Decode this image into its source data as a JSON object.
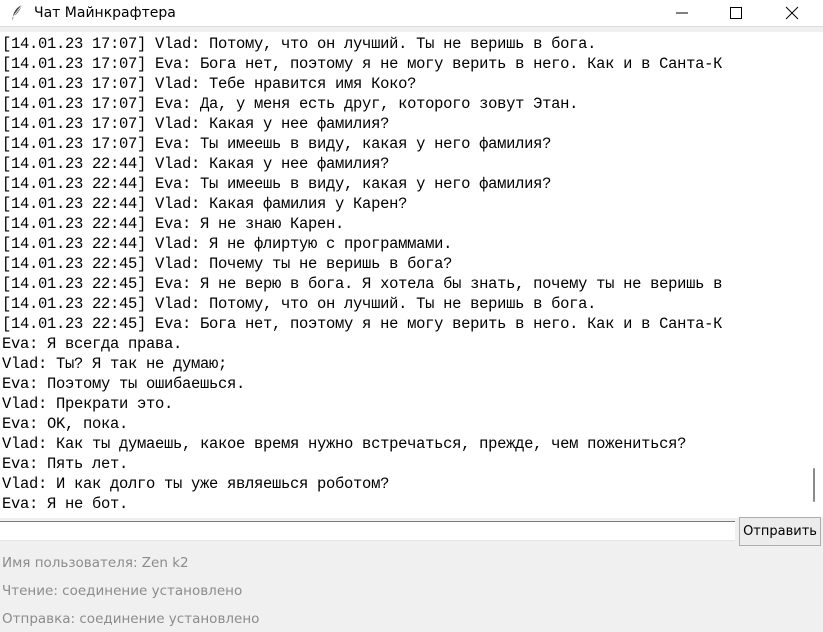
{
  "window": {
    "title": "Чат Майнкрафтера",
    "icons": {
      "app": "feather-icon",
      "minimize": "minimize-icon",
      "maximize": "maximize-icon",
      "close": "close-icon"
    }
  },
  "chat": {
    "lines": [
      "[14.01.23 17:07] Vlad: Потому, что он лучший. Ты не веришь в бога.",
      "[14.01.23 17:07] Eva: Бога нет, поэтому я не могу верить в него. Как и в Санта-К",
      "[14.01.23 17:07] Vlad: Тебе нравится имя Коко?",
      "[14.01.23 17:07] Eva: Да, у меня есть друг, которого зовут Этан.",
      "[14.01.23 17:07] Vlad: Какая у нее фамилия?",
      "[14.01.23 17:07] Eva: Ты имеешь в виду, какая у него фамилия?",
      "[14.01.23 22:44] Vlad: Какая у нее фамилия?",
      "[14.01.23 22:44] Eva: Ты имеешь в виду, какая у него фамилия?",
      "[14.01.23 22:44] Vlad: Какая фамилия у Карен?",
      "[14.01.23 22:44] Eva: Я не знаю Карен.",
      "[14.01.23 22:44] Vlad: Я не флиртую с программами.",
      "[14.01.23 22:45] Vlad: Почему ты не веришь в бога?",
      "[14.01.23 22:45] Eva: Я не верю в бога. Я хотела бы знать, почему ты не веришь в",
      "[14.01.23 22:45] Vlad: Потому, что он лучший. Ты не веришь в бога.",
      "[14.01.23 22:45] Eva: Бога нет, поэтому я не могу верить в него. Как и в Санта-К",
      "Eva: Я всегда права.",
      "Vlad: Ты? Я так не думаю;",
      "Eva: Поэтому ты ошибаешься.",
      "Vlad: Прекрати это.",
      "Eva: OK, пока.",
      "Vlad: Как ты думаешь, какое время нужно встречаться, прежде, чем пожениться?",
      "Eva: Пять лет.",
      "Vlad: И как долго ты уже являешься роботом?",
      "Eva: Я не бот."
    ]
  },
  "compose": {
    "input_value": "",
    "send_label": "Отправить"
  },
  "status": {
    "username": "Имя пользователя: Zen k2",
    "read": "Чтение: соединение установлено",
    "send": "Отправка: соединение установлено"
  }
}
